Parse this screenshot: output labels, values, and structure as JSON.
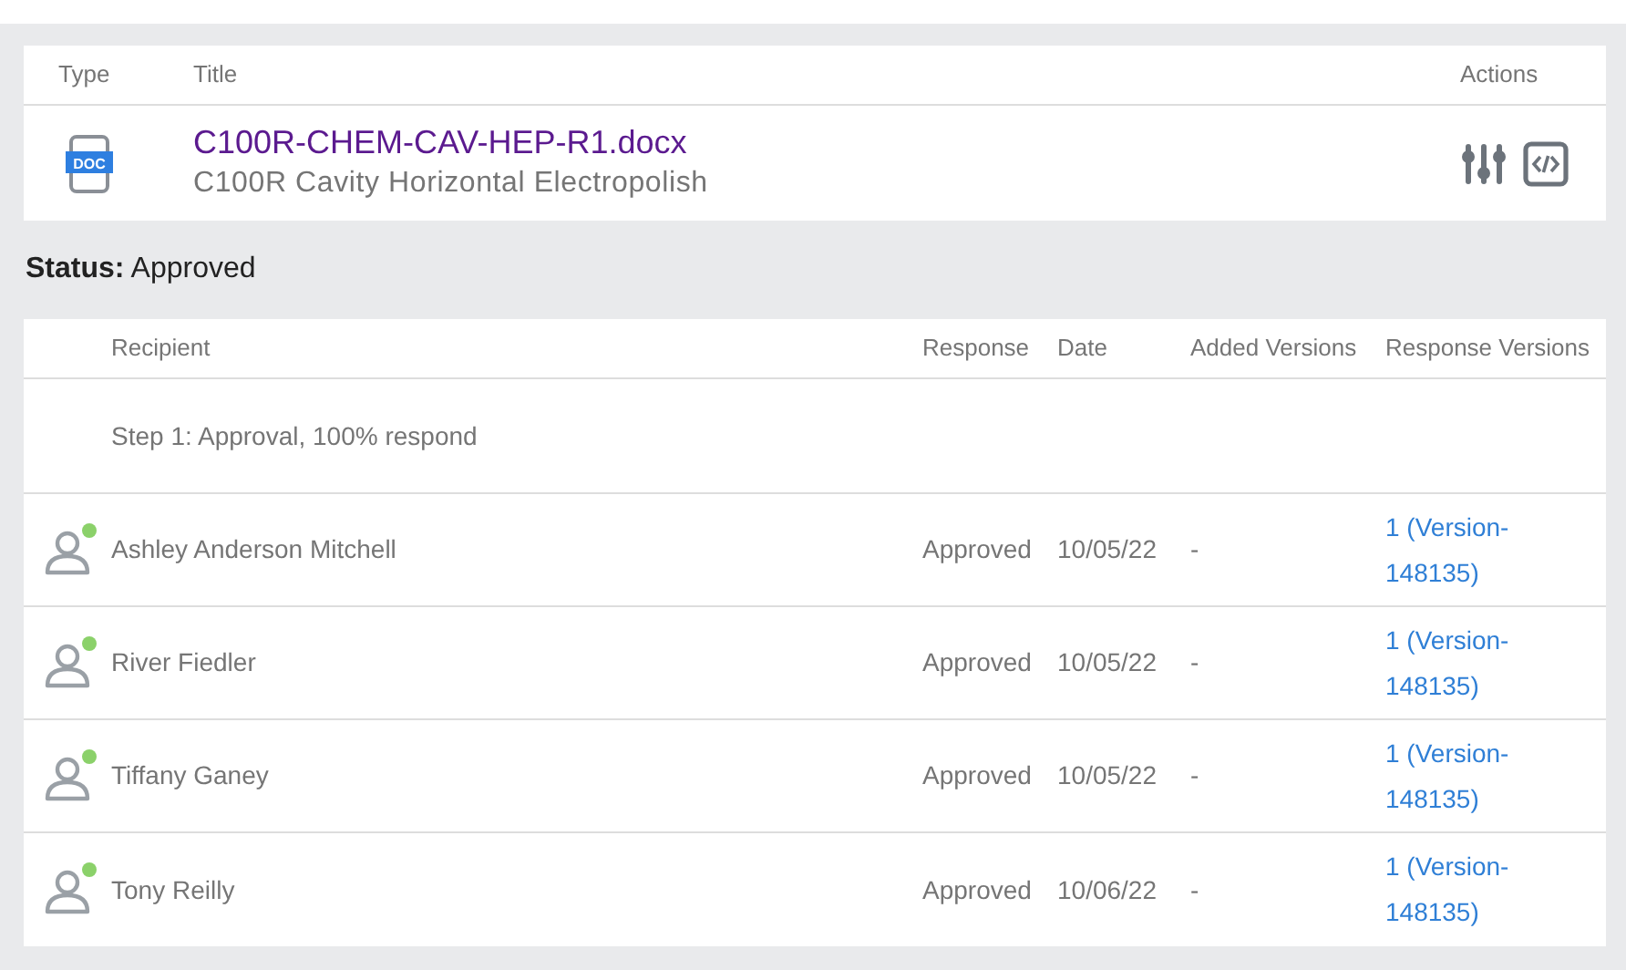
{
  "document": {
    "columns": [
      "Type",
      "Title",
      "Actions"
    ],
    "type_label": "DOC",
    "file_name": "C100R-CHEM-CAV-HEP-R1.docx",
    "description": "C100R Cavity Horizontal Electropolish"
  },
  "status": {
    "label": "Status:",
    "value": "Approved"
  },
  "recipients": {
    "columns": [
      "Recipient",
      "Response",
      "Date",
      "Added Versions",
      "Response Versions"
    ],
    "step": "Step 1: Approval, 100% respond",
    "rows": [
      {
        "name": "Ashley Anderson Mitchell",
        "color": "#8bd16a",
        "response": "Approved",
        "date": "10/05/22",
        "added": "-",
        "version": "1 (Version-148135)"
      },
      {
        "name": "River Fiedler",
        "color": "#8bd16a",
        "response": "Approved",
        "date": "10/05/22",
        "added": "-",
        "version": "1 (Version-148135)"
      },
      {
        "name": "Tiffany Ganey",
        "color": "#8bd16a",
        "response": "Approved",
        "date": "10/05/22",
        "added": "-",
        "version": "1 (Version-148135)"
      },
      {
        "name": "Tony Reilly",
        "color": "#8bd16a",
        "response": "Approved",
        "date": "10/06/22",
        "added": "-",
        "version": "1 (Version-148135)"
      }
    ]
  }
}
